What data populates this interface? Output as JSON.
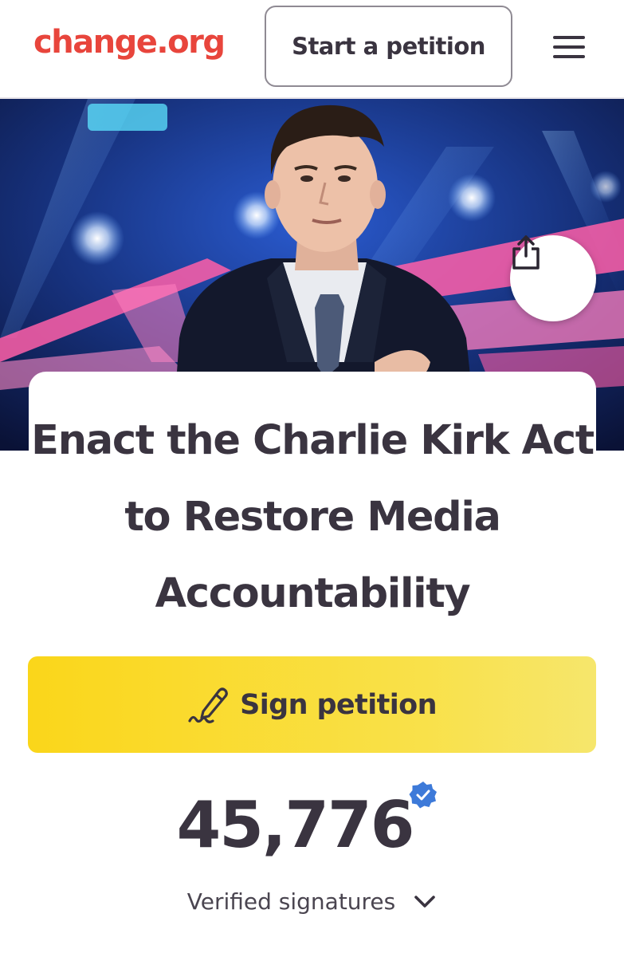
{
  "header": {
    "logo_text": "change.org",
    "start_button_label": "Start a petition",
    "menu_icon": "hamburger-menu-icon"
  },
  "hero": {
    "share_icon": "share-icon"
  },
  "petition": {
    "title": "Enact the Charlie Kirk Act to Restore Media Accountability",
    "sign_button_label": "Sign petition",
    "sign_icon": "pen-signature-icon",
    "signature_count": "45,776",
    "verified_label": "Verified signatures",
    "verified_icon": "verified-badge-icon",
    "expand_icon": "chevron-down-icon"
  },
  "colors": {
    "brand": "#e8453c",
    "sign_button": "#fad61a",
    "text": "#3a3440",
    "verified_blue": "#3d7ad9"
  }
}
